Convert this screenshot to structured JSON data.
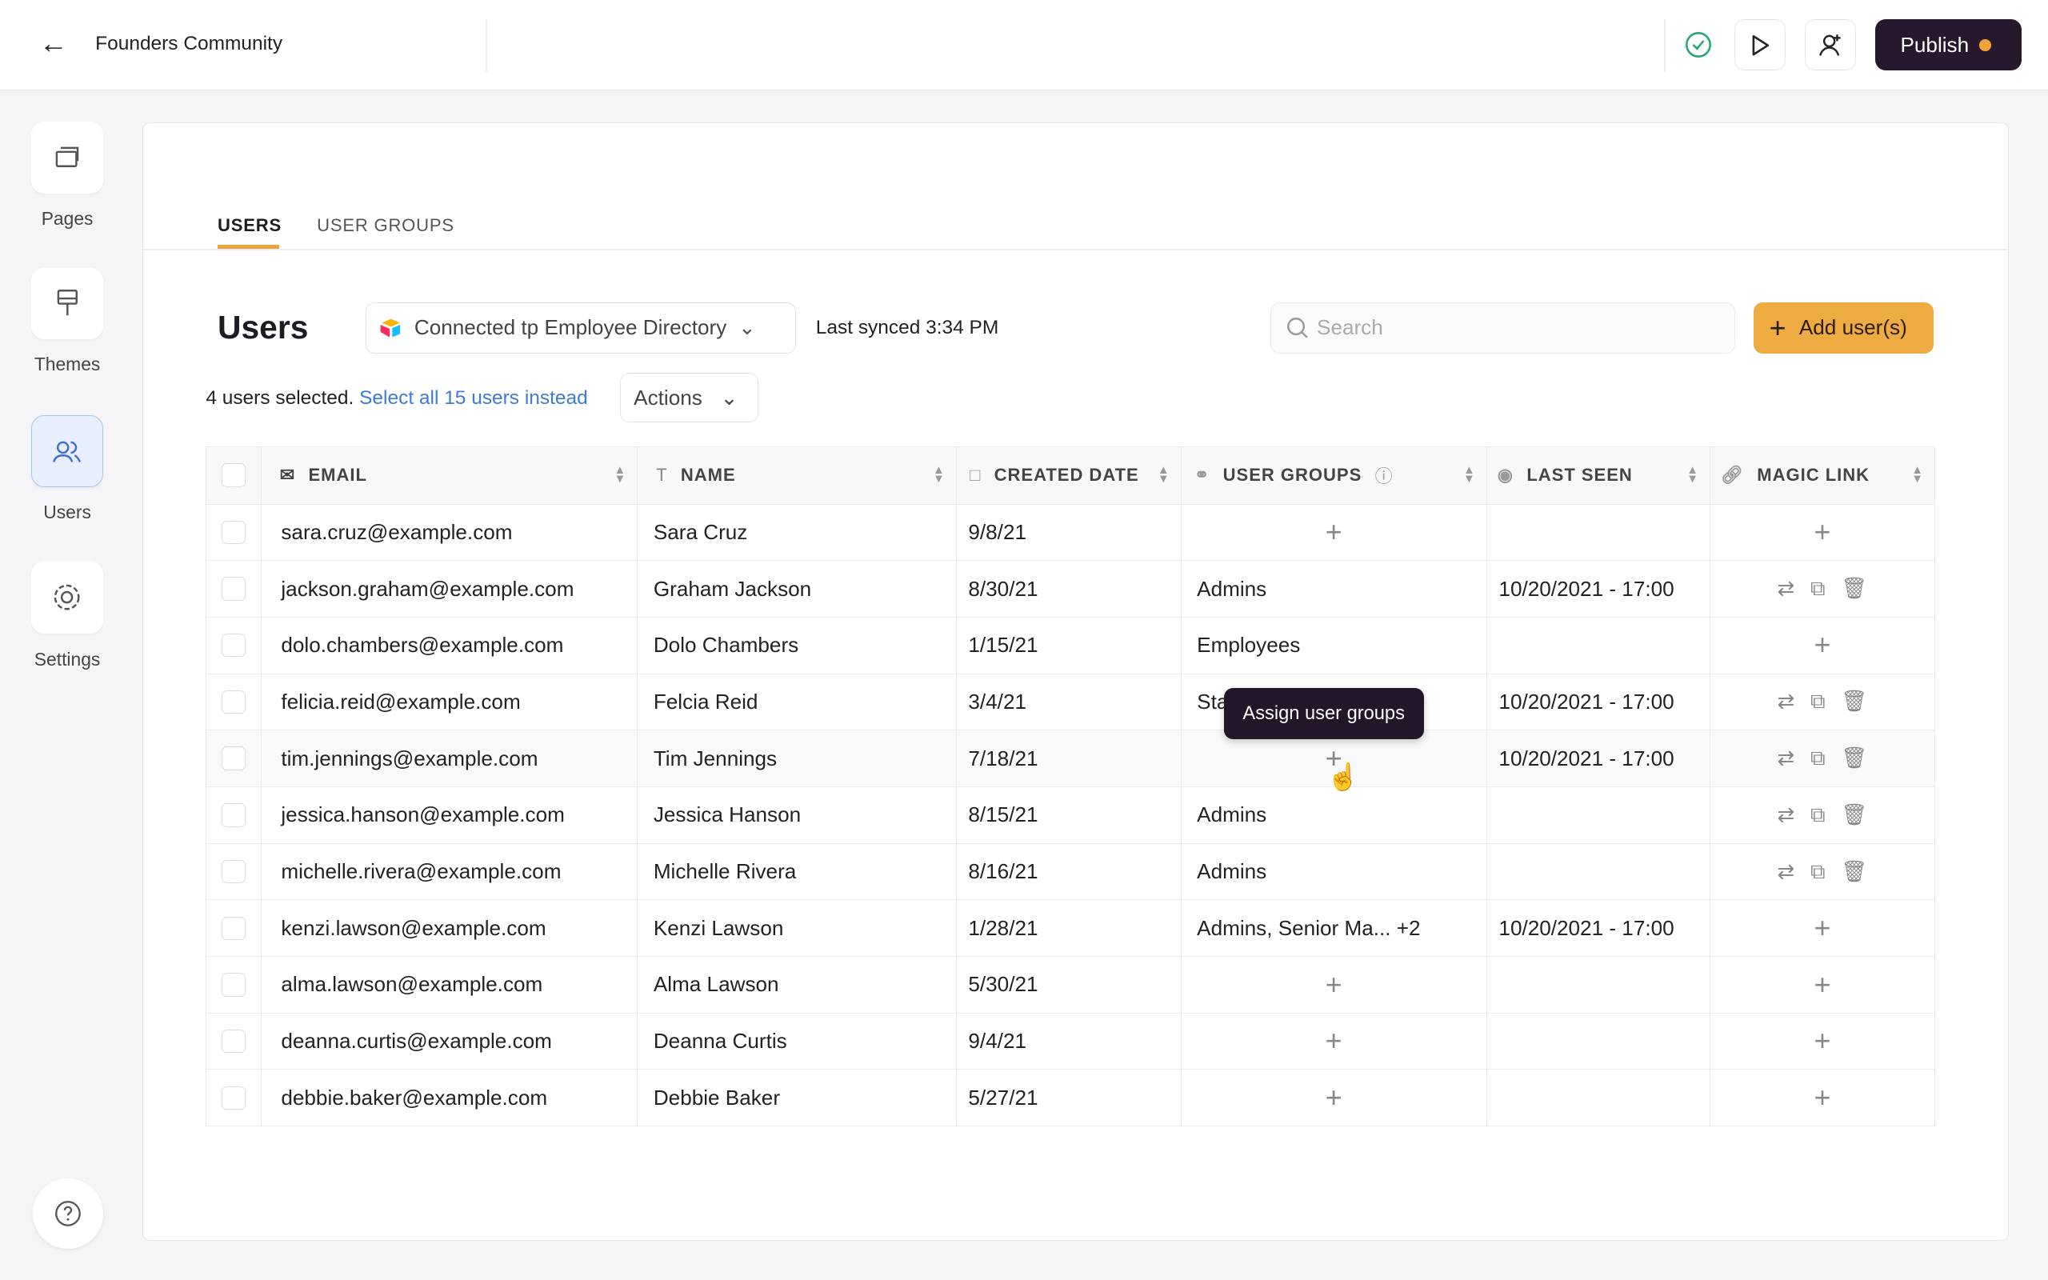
{
  "header": {
    "title": "Founders Community",
    "publish_label": "Publish",
    "status_color": "#2aa772",
    "accent": "#eeab42"
  },
  "sidebar": {
    "items": [
      {
        "label": "Pages",
        "icon": "pages-icon"
      },
      {
        "label": "Themes",
        "icon": "paintbrush-icon"
      },
      {
        "label": "Users",
        "icon": "users-icon",
        "active": true
      },
      {
        "label": "Settings",
        "icon": "gear-icon"
      }
    ]
  },
  "tabs": [
    {
      "label": "USERS",
      "active": true
    },
    {
      "label": "USER GROUPS"
    }
  ],
  "users": {
    "title": "Users",
    "connection": "Connected tp Employee Directory",
    "last_synced": "Last synced 3:34 PM",
    "search_placeholder": "Search",
    "add_label": "Add user(s)",
    "selected_text": "4 users selected.",
    "select_all_link": "Select all 15 users instead",
    "actions_label": "Actions"
  },
  "table": {
    "columns": [
      "EMAIL",
      "NAME",
      "CREATED DATE",
      "USER GROUPS",
      "LAST SEEN",
      "MAGIC LINK"
    ],
    "rows": [
      {
        "email": "sara.cruz@example.com",
        "name": "Sara Cruz",
        "created": "9/8/21",
        "groups": "",
        "last_seen": "",
        "magic": "add"
      },
      {
        "email": "jackson.graham@example.com",
        "name": "Graham Jackson",
        "created": "8/30/21",
        "groups": "Admins",
        "last_seen": "10/20/2021 - 17:00",
        "magic": "actions"
      },
      {
        "email": "dolo.chambers@example.com",
        "name": "Dolo Chambers",
        "created": "1/15/21",
        "groups": "Employees",
        "last_seen": "",
        "magic": "add"
      },
      {
        "email": "felicia.reid@example.com",
        "name": "Felcia Reid",
        "created": "3/4/21",
        "groups": "Sta",
        "last_seen": "10/20/2021 - 17:00",
        "magic": "actions"
      },
      {
        "email": "tim.jennings@example.com",
        "name": "Tim Jennings",
        "created": "7/18/21",
        "groups": "",
        "last_seen": "10/20/2021 - 17:00",
        "magic": "actions",
        "hover": true
      },
      {
        "email": "jessica.hanson@example.com",
        "name": "Jessica Hanson",
        "created": "8/15/21",
        "groups": "Admins",
        "last_seen": "",
        "magic": "actions"
      },
      {
        "email": "michelle.rivera@example.com",
        "name": "Michelle Rivera",
        "created": "8/16/21",
        "groups": "Admins",
        "last_seen": "",
        "magic": "actions"
      },
      {
        "email": "kenzi.lawson@example.com",
        "name": "Kenzi Lawson",
        "created": "1/28/21",
        "groups": "Admins, Senior Ma... +2",
        "last_seen": "10/20/2021 - 17:00",
        "magic": "add"
      },
      {
        "email": "alma.lawson@example.com",
        "name": "Alma Lawson",
        "created": "5/30/21",
        "groups": "",
        "last_seen": "",
        "magic": "add"
      },
      {
        "email": "deanna.curtis@example.com",
        "name": "Deanna Curtis",
        "created": "9/4/21",
        "groups": "",
        "last_seen": "",
        "magic": "add"
      },
      {
        "email": "debbie.baker@example.com",
        "name": "Debbie Baker",
        "created": "5/27/21",
        "groups": "",
        "last_seen": "",
        "magic": "add"
      }
    ]
  },
  "tooltip": "Assign user groups"
}
